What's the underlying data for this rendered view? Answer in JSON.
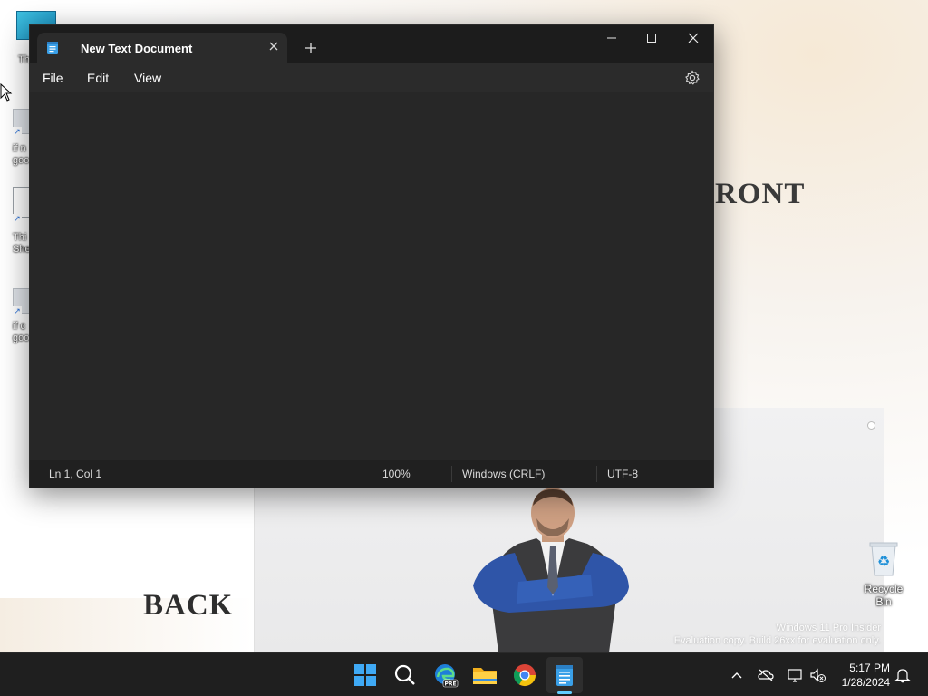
{
  "desktop": {
    "wallpaper_text_front": "RONT",
    "wallpaper_text_back": "BACK",
    "watermark_line1": "Windows 11 Pro Insider",
    "watermark_line2": "Evaluation copy. Build 26xx for evaluation only.",
    "icons": [
      {
        "label": "Th"
      },
      {
        "label": "if n\ngoo"
      },
      {
        "label": "Thi\nShe"
      },
      {
        "label": "if c\ngoo"
      }
    ],
    "recycle_bin_label": "Recycle Bin"
  },
  "notepad": {
    "tab_title": "New Text Document",
    "menu": [
      "File",
      "Edit",
      "View"
    ],
    "content": "",
    "status": {
      "position": "Ln 1, Col 1",
      "zoom": "100%",
      "line_ending": "Windows (CRLF)",
      "encoding": "UTF-8"
    }
  },
  "taskbar": {
    "apps": [
      "start-icon",
      "search-icon",
      "edge-pre-icon",
      "file-explorer-icon",
      "chrome-icon",
      "notepad-icon"
    ],
    "time": "5:17 PM",
    "date": "1/28/2024"
  },
  "colors": {
    "window_bg": "#202020",
    "editor_bg": "#272727",
    "accent": "#60cdff",
    "taskbar_bg": "#1f1f1f"
  }
}
